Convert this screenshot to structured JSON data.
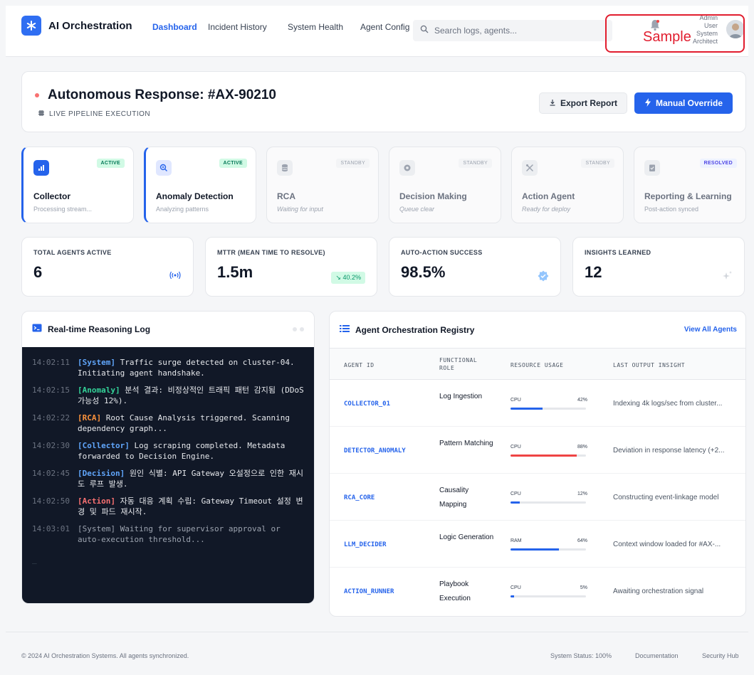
{
  "app": {
    "brand": "AI Orchestration",
    "nav": [
      "Dashboard",
      "Incident History",
      "System Health",
      "Agent Config"
    ],
    "search_placeholder": "Search logs, agents...",
    "user_lines": [
      "Admin",
      "User",
      "System",
      "Architect"
    ],
    "watermark": "Sample"
  },
  "header": {
    "title": "Autonomous Response: #AX-90210",
    "subtitle": "LIVE PIPELINE EXECUTION",
    "export_label": "Export Report",
    "override_label": "Manual Override"
  },
  "pipeline": [
    {
      "name": "Collector",
      "desc": "Processing stream...",
      "status": "ACTIVE"
    },
    {
      "name": "Anomaly Detection",
      "desc": "Analyzing patterns",
      "status": "ACTIVE"
    },
    {
      "name": "RCA",
      "desc": "Waiting for input",
      "status": "STANDBY"
    },
    {
      "name": "Decision Making",
      "desc": "Queue clear",
      "status": "STANDBY"
    },
    {
      "name": "Action Agent",
      "desc": "Ready for deploy",
      "status": "STANDBY"
    },
    {
      "name": "Reporting & Learning",
      "desc": "Post-action synced",
      "status": "RESOLVED"
    }
  ],
  "metrics": [
    {
      "label": "TOTAL AGENTS ACTIVE",
      "value": "6"
    },
    {
      "label": "MTTR (MEAN TIME TO RESOLVE)",
      "value": "1.5m",
      "trend": "40.2%"
    },
    {
      "label": "AUTO-ACTION SUCCESS",
      "value": "98.5%"
    },
    {
      "label": "INSIGHTS LEARNED",
      "value": "12"
    }
  ],
  "log": {
    "title": "Real-time Reasoning Log",
    "entries": [
      {
        "time": "14:02:11",
        "tag": "[System]",
        "text": " Traffic surge detected on cluster-04. Initiating agent handshake."
      },
      {
        "time": "14:02:15",
        "tag": "[Anomaly]",
        "text": " 분석 결과: 비정상적인 트래픽 패턴 감지됨 (DDoS 가능성 12%)."
      },
      {
        "time": "14:02:22",
        "tag": "[RCA]",
        "text": " Root Cause Analysis triggered. Scanning dependency graph..."
      },
      {
        "time": "14:02:30",
        "tag": "[Collector]",
        "text": " Log scraping completed. Metadata forwarded to Decision Engine."
      },
      {
        "time": "14:02:45",
        "tag": "[Decision]",
        "text": " 원인 식별: API Gateway 오설정으로 인한 재시도 루프 발생."
      },
      {
        "time": "14:02:50",
        "tag": "[Action]",
        "text": " 자동 대응 계획 수립: Gateway Timeout 설정 변경 및 파드 재시작."
      },
      {
        "time": "14:03:01",
        "tag": "[System]",
        "text": " Waiting for supervisor approval or auto-execution threshold..."
      }
    ],
    "cursor": "_"
  },
  "registry": {
    "title": "Agent Orchestration Registry",
    "view_all": "View All Agents",
    "columns": [
      "AGENT ID",
      "FUNCTIONAL ROLE",
      "RESOURCE USAGE",
      "LAST OUTPUT INSIGHT"
    ],
    "rows": [
      {
        "id": "COLLECTOR_01",
        "role": "Log Ingestion",
        "res": "CPU",
        "pct": "42%",
        "usage": 0.42,
        "insight": "Indexing 4k logs/sec from cluster..."
      },
      {
        "id": "DETECTOR_ANOMALY",
        "role": "Pattern Matching",
        "res": "CPU",
        "pct": "88%",
        "usage": 0.88,
        "insight": "Deviation in response latency (+2..."
      },
      {
        "id": "RCA_CORE",
        "role": "Causality Mapping",
        "res": "CPU",
        "pct": "12%",
        "usage": 0.12,
        "insight": "Constructing event-linkage model"
      },
      {
        "id": "LLM_DECIDER",
        "role": "Logic Generation",
        "res": "RAM",
        "pct": "64%",
        "usage": 0.64,
        "insight": "Context window loaded for #AX-..."
      },
      {
        "id": "ACTION_RUNNER",
        "role": "Playbook Execution",
        "res": "CPU",
        "pct": "5%",
        "usage": 0.05,
        "insight": "Awaiting orchestration signal"
      }
    ]
  },
  "footer": {
    "copyright": "© 2024 AI Orchestration Systems. All agents synchronized.",
    "links": [
      "System Status: 100%",
      "Documentation",
      "Security Hub"
    ]
  },
  "colors": {
    "accent": "#2563eb",
    "tag_system": "#60a5fa",
    "tag_anomaly": "#34d399",
    "tag_rca": "#fb923c",
    "tag_collector": "#60a5fa",
    "tag_decision": "#60a5fa",
    "tag_action": "#f87171",
    "tag_system_idle": "#9ca3af"
  },
  "icons": {
    "logo": "asterisk-icon",
    "search": "search-icon",
    "bell": "bell-icon",
    "export": "download-icon",
    "override": "bolt-icon"
  }
}
